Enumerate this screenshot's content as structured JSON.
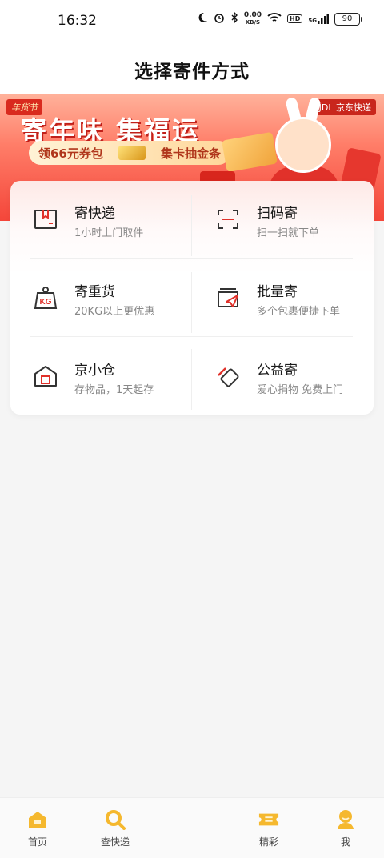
{
  "status_bar": {
    "time": "16:32",
    "net_speed_value": "0.00",
    "net_speed_unit": "KB/S",
    "hd_label": "HD",
    "signal_label": "5G",
    "battery": "90"
  },
  "header": {
    "title": "选择寄件方式"
  },
  "banner": {
    "tag": "年货节",
    "logo": "JDL 京东快递",
    "title": "寄年味 集福运",
    "pill_left": "领66元券包",
    "pill_right": "集卡抽金条"
  },
  "services": [
    {
      "name": "寄快递",
      "desc": "1小时上门取件",
      "icon": "package-box-icon"
    },
    {
      "name": "扫码寄",
      "desc": "扫一扫就下单",
      "icon": "scan-icon"
    },
    {
      "name": "寄重货",
      "desc": "20KG以上更优惠",
      "icon": "kg-weight-icon",
      "icon_text": "KG"
    },
    {
      "name": "批量寄",
      "desc": "多个包裹便捷下单",
      "icon": "batch-send-icon"
    },
    {
      "name": "京小仓",
      "desc": "存物品，1天起存",
      "icon": "warehouse-icon"
    },
    {
      "name": "公益寄",
      "desc": "爱心捐物 免费上门",
      "icon": "charity-icon"
    }
  ],
  "tabbar": [
    {
      "label": "首页",
      "icon": "home-icon"
    },
    {
      "label": "查快递",
      "icon": "search-icon"
    },
    {
      "label": "精彩",
      "icon": "ticket-icon"
    },
    {
      "label": "我",
      "icon": "profile-icon"
    }
  ],
  "colors": {
    "accent": "#f4463a",
    "tab_icon": "#f5b82e",
    "icon_red": "#e0312a"
  }
}
